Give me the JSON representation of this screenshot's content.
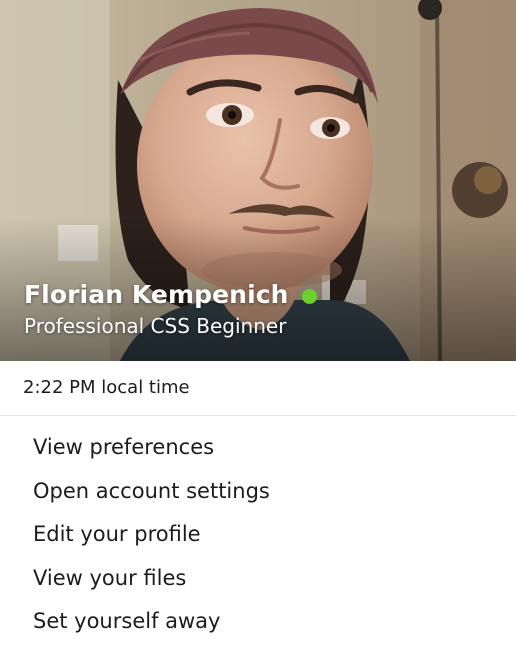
{
  "profile": {
    "name": "Florian Kempenich",
    "title": "Professional CSS Beginner",
    "status": "online",
    "status_color": "#6ad02b"
  },
  "local_time": "2:22 PM local time",
  "menu": {
    "items": [
      {
        "label": "View preferences"
      },
      {
        "label": "Open account settings"
      },
      {
        "label": "Edit your profile"
      },
      {
        "label": "View your files"
      },
      {
        "label": "Set yourself away"
      }
    ]
  }
}
